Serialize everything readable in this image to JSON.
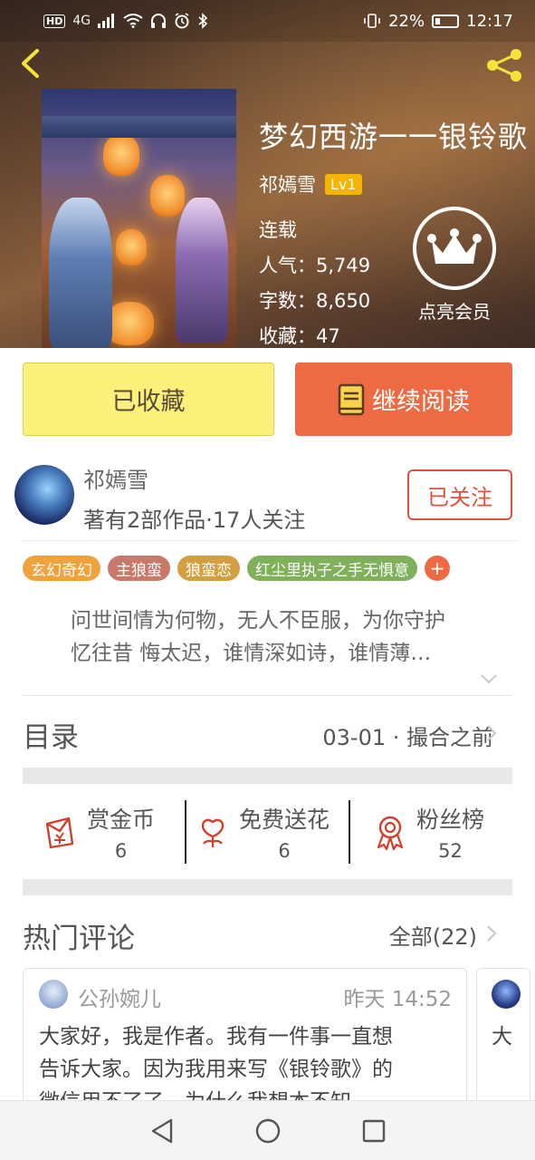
{
  "status_bar": {
    "hd_label": "HD",
    "network_label": "4G",
    "battery_percent": "22%",
    "time": "12:17"
  },
  "book": {
    "title": "梦幻西游一一银铃歌",
    "author": "祁嫣雪",
    "level_badge": "Lv1",
    "status": "连载",
    "popularity_label": "人气：",
    "popularity_value": "5,749",
    "word_count_label": "字数：",
    "word_count_value": "8,650",
    "favorites_label": "收藏：",
    "favorites_value": "47",
    "vip_label": "点亮会员"
  },
  "actions": {
    "collected_label": "已收藏",
    "continue_reading_label": "继续阅读"
  },
  "author_section": {
    "name": "祁嫣雪",
    "meta": "著有2部作品·17人关注",
    "follow_label": "已关注"
  },
  "tags": [
    {
      "label": "玄幻奇幻",
      "color": "#f0a23c"
    },
    {
      "label": "主狼蛮",
      "color": "#c9796a"
    },
    {
      "label": "狼蛮恋",
      "color": "#d2a040"
    },
    {
      "label": "红尘里执子之手无惧意",
      "color": "#7fb05a"
    }
  ],
  "tag_more_label": "+",
  "tag_more_color": "#ed6a42",
  "summary": {
    "line1": "问世间情为何物，无人不臣服，为你守护",
    "line2": "忆往昔 悔太迟，谁情深如诗，谁情薄…"
  },
  "toc": {
    "title": "目录",
    "latest_chapter": "03-01 · 撮合之前"
  },
  "support": [
    {
      "label": "赏金币",
      "count": "6",
      "icon": "red-envelope-yen-icon"
    },
    {
      "label": "免费送花",
      "count": "6",
      "icon": "flower-icon"
    },
    {
      "label": "粉丝榜",
      "count": "52",
      "icon": "medal-icon"
    }
  ],
  "hot_comments": {
    "title": "热门评论",
    "all_label": "全部(22)",
    "items": [
      {
        "user": "公孙婉儿",
        "time": "昨天 14:52",
        "line1": "大家好，我是作者。我有一件事一直想",
        "line2": "告诉大家。因为我用来写《银铃歌》的",
        "line3": "微信用不了了，为什么我想本不知"
      },
      {
        "text_start": "大"
      }
    ]
  },
  "colors": {
    "accent_orange": "#ed6a42",
    "collected_yellow": "#fbf07a",
    "follow_red": "#e0513a",
    "level_gold": "#f5b400"
  },
  "nav": {
    "back_icon": "triangle-back-icon",
    "home_icon": "circle-home-icon",
    "recents_icon": "square-recents-icon"
  }
}
